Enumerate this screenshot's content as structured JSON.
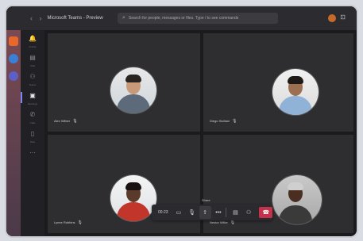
{
  "titlebar": {
    "title": "Microsoft Teams - Preview",
    "nav": "‹ ›",
    "compose_icon": "compose-icon",
    "search_placeholder": "Search for people, messages or files. Type / to see commands",
    "window_controls": "⊡"
  },
  "rail": [
    {
      "name": "activity",
      "icon": "bell-icon",
      "glyph": "🔔",
      "label": "Activity"
    },
    {
      "name": "chat",
      "icon": "chat-icon",
      "glyph": "▤",
      "label": "Chat"
    },
    {
      "name": "teams",
      "icon": "teams-icon",
      "glyph": "⚇",
      "label": "Teams"
    },
    {
      "name": "meetings",
      "icon": "calendar-icon",
      "glyph": "▣",
      "label": "Meetings",
      "active": true
    },
    {
      "name": "calls",
      "icon": "phone-icon",
      "glyph": "✆",
      "label": "Calls"
    },
    {
      "name": "files",
      "icon": "file-icon",
      "glyph": "▯",
      "label": "Files"
    },
    {
      "name": "more",
      "icon": "more-icon",
      "glyph": "···",
      "label": ""
    }
  ],
  "participants": [
    {
      "name": "Alex Wilber",
      "mic": "🎙"
    },
    {
      "name": "Diego Siciliani",
      "mic": "🎙"
    },
    {
      "name": "Lynne Robbins",
      "mic": "🎙"
    },
    {
      "name": "Nestor Wilke",
      "mic": "🎙"
    }
  ],
  "callbar": {
    "timer": "00:23",
    "share_tooltip": "Share",
    "buttons": [
      {
        "name": "camera-button",
        "glyph": "▭"
      },
      {
        "name": "mic-button",
        "glyph": "🎙"
      },
      {
        "name": "share-button",
        "glyph": "⇪"
      },
      {
        "name": "more-actions-button",
        "glyph": "•••"
      },
      {
        "name": "chat-toggle-button",
        "glyph": "▤"
      },
      {
        "name": "participants-button",
        "glyph": "⚇"
      }
    ],
    "hangup_glyph": "☎"
  },
  "colors": {
    "accent": "#7f85f5",
    "hangup": "#c4314b"
  }
}
